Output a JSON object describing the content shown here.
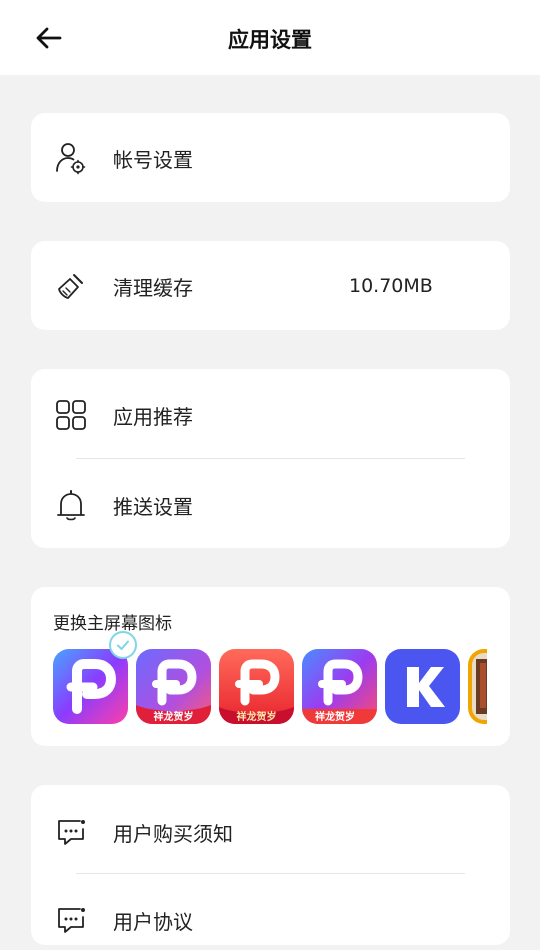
{
  "header": {
    "title": "应用设置",
    "back_icon": "arrow-left-icon"
  },
  "account": {
    "label": "帐号设置",
    "icon": "user-gear-icon"
  },
  "cache": {
    "label": "清理缓存",
    "value": "10.70MB",
    "icon": "broom-icon"
  },
  "recommend": {
    "label": "应用推荐",
    "icon": "grid-icon"
  },
  "push": {
    "label": "推送设置",
    "icon": "bell-icon"
  },
  "home_icon": {
    "title": "更换主屏幕图标",
    "options": [
      {
        "name": "default-p",
        "selected": true
      },
      {
        "name": "festival-p-purple",
        "badge": "祥龙贺岁"
      },
      {
        "name": "festival-p-red",
        "badge": "祥龙贺岁"
      },
      {
        "name": "festival-p-blue",
        "badge": "祥龙贺岁"
      },
      {
        "name": "k-logo"
      },
      {
        "name": "partial-photo"
      }
    ]
  },
  "purchase_notice": {
    "label": "用户购买须知",
    "icon": "message-dots-icon"
  },
  "agreement": {
    "label": "用户协议",
    "icon": "message-dots-icon"
  },
  "colors": {
    "background": "#f2f2f2",
    "card": "#ffffff",
    "selected_ring": "#7fd6e6",
    "k_blue": "#4b56f0"
  }
}
